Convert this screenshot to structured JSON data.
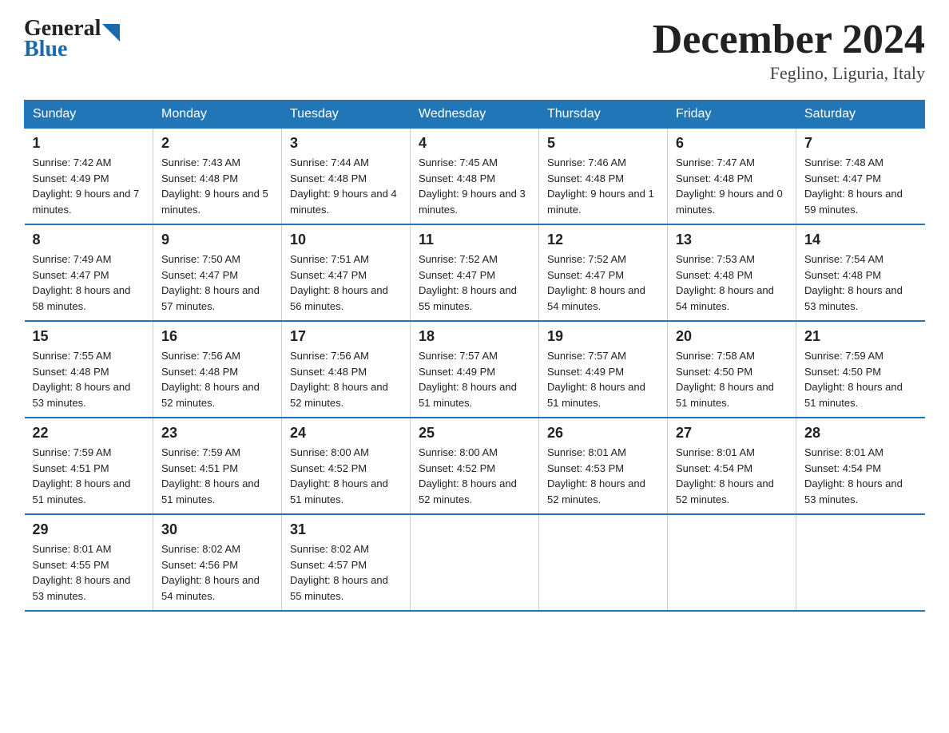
{
  "logo": {
    "general": "General",
    "blue": "Blue"
  },
  "title": "December 2024",
  "location": "Feglino, Liguria, Italy",
  "days_of_week": [
    "Sunday",
    "Monday",
    "Tuesday",
    "Wednesday",
    "Thursday",
    "Friday",
    "Saturday"
  ],
  "weeks": [
    [
      {
        "day": "1",
        "sunrise": "7:42 AM",
        "sunset": "4:49 PM",
        "daylight": "9 hours and 7 minutes."
      },
      {
        "day": "2",
        "sunrise": "7:43 AM",
        "sunset": "4:48 PM",
        "daylight": "9 hours and 5 minutes."
      },
      {
        "day": "3",
        "sunrise": "7:44 AM",
        "sunset": "4:48 PM",
        "daylight": "9 hours and 4 minutes."
      },
      {
        "day": "4",
        "sunrise": "7:45 AM",
        "sunset": "4:48 PM",
        "daylight": "9 hours and 3 minutes."
      },
      {
        "day": "5",
        "sunrise": "7:46 AM",
        "sunset": "4:48 PM",
        "daylight": "9 hours and 1 minute."
      },
      {
        "day": "6",
        "sunrise": "7:47 AM",
        "sunset": "4:48 PM",
        "daylight": "9 hours and 0 minutes."
      },
      {
        "day": "7",
        "sunrise": "7:48 AM",
        "sunset": "4:47 PM",
        "daylight": "8 hours and 59 minutes."
      }
    ],
    [
      {
        "day": "8",
        "sunrise": "7:49 AM",
        "sunset": "4:47 PM",
        "daylight": "8 hours and 58 minutes."
      },
      {
        "day": "9",
        "sunrise": "7:50 AM",
        "sunset": "4:47 PM",
        "daylight": "8 hours and 57 minutes."
      },
      {
        "day": "10",
        "sunrise": "7:51 AM",
        "sunset": "4:47 PM",
        "daylight": "8 hours and 56 minutes."
      },
      {
        "day": "11",
        "sunrise": "7:52 AM",
        "sunset": "4:47 PM",
        "daylight": "8 hours and 55 minutes."
      },
      {
        "day": "12",
        "sunrise": "7:52 AM",
        "sunset": "4:47 PM",
        "daylight": "8 hours and 54 minutes."
      },
      {
        "day": "13",
        "sunrise": "7:53 AM",
        "sunset": "4:48 PM",
        "daylight": "8 hours and 54 minutes."
      },
      {
        "day": "14",
        "sunrise": "7:54 AM",
        "sunset": "4:48 PM",
        "daylight": "8 hours and 53 minutes."
      }
    ],
    [
      {
        "day": "15",
        "sunrise": "7:55 AM",
        "sunset": "4:48 PM",
        "daylight": "8 hours and 53 minutes."
      },
      {
        "day": "16",
        "sunrise": "7:56 AM",
        "sunset": "4:48 PM",
        "daylight": "8 hours and 52 minutes."
      },
      {
        "day": "17",
        "sunrise": "7:56 AM",
        "sunset": "4:48 PM",
        "daylight": "8 hours and 52 minutes."
      },
      {
        "day": "18",
        "sunrise": "7:57 AM",
        "sunset": "4:49 PM",
        "daylight": "8 hours and 51 minutes."
      },
      {
        "day": "19",
        "sunrise": "7:57 AM",
        "sunset": "4:49 PM",
        "daylight": "8 hours and 51 minutes."
      },
      {
        "day": "20",
        "sunrise": "7:58 AM",
        "sunset": "4:50 PM",
        "daylight": "8 hours and 51 minutes."
      },
      {
        "day": "21",
        "sunrise": "7:59 AM",
        "sunset": "4:50 PM",
        "daylight": "8 hours and 51 minutes."
      }
    ],
    [
      {
        "day": "22",
        "sunrise": "7:59 AM",
        "sunset": "4:51 PM",
        "daylight": "8 hours and 51 minutes."
      },
      {
        "day": "23",
        "sunrise": "7:59 AM",
        "sunset": "4:51 PM",
        "daylight": "8 hours and 51 minutes."
      },
      {
        "day": "24",
        "sunrise": "8:00 AM",
        "sunset": "4:52 PM",
        "daylight": "8 hours and 51 minutes."
      },
      {
        "day": "25",
        "sunrise": "8:00 AM",
        "sunset": "4:52 PM",
        "daylight": "8 hours and 52 minutes."
      },
      {
        "day": "26",
        "sunrise": "8:01 AM",
        "sunset": "4:53 PM",
        "daylight": "8 hours and 52 minutes."
      },
      {
        "day": "27",
        "sunrise": "8:01 AM",
        "sunset": "4:54 PM",
        "daylight": "8 hours and 52 minutes."
      },
      {
        "day": "28",
        "sunrise": "8:01 AM",
        "sunset": "4:54 PM",
        "daylight": "8 hours and 53 minutes."
      }
    ],
    [
      {
        "day": "29",
        "sunrise": "8:01 AM",
        "sunset": "4:55 PM",
        "daylight": "8 hours and 53 minutes."
      },
      {
        "day": "30",
        "sunrise": "8:02 AM",
        "sunset": "4:56 PM",
        "daylight": "8 hours and 54 minutes."
      },
      {
        "day": "31",
        "sunrise": "8:02 AM",
        "sunset": "4:57 PM",
        "daylight": "8 hours and 55 minutes."
      },
      null,
      null,
      null,
      null
    ]
  ],
  "labels": {
    "sunrise": "Sunrise:",
    "sunset": "Sunset:",
    "daylight": "Daylight:"
  }
}
